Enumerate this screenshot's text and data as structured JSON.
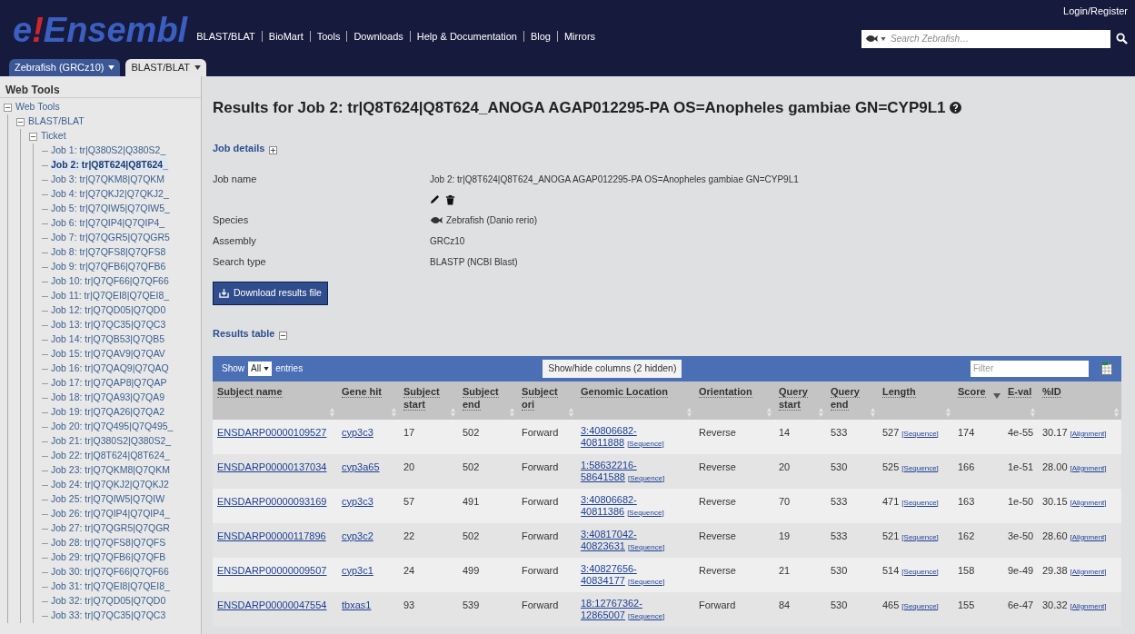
{
  "header": {
    "logo_mark": "e!",
    "logo_text": "Ensembl",
    "nav": [
      "BLAST/BLAT",
      "BioMart",
      "Tools",
      "Downloads",
      "Help & Documentation",
      "Blog",
      "Mirrors"
    ],
    "login": "Login/Register",
    "search": {
      "placeholder": "Search Zebrafish…"
    }
  },
  "tabs": [
    {
      "label": "Zebrafish (GRCz10)",
      "selected": false
    },
    {
      "label": "BLAST/BLAT",
      "selected": true
    }
  ],
  "sidebar": {
    "title": "Web Tools",
    "tree": [
      {
        "label": "Web Tools",
        "expanded": true,
        "children": [
          {
            "label": "BLAST/BLAT",
            "expanded": true,
            "children": [
              {
                "label": "Ticket",
                "expanded": true,
                "children": [
                  {
                    "label": "Job 1: tr|Q380S2|Q380S2_",
                    "selected": false
                  },
                  {
                    "label": "Job 2: tr|Q8T624|Q8T624_",
                    "selected": true
                  },
                  {
                    "label": "Job 3: tr|Q7QKM8|Q7QKM",
                    "selected": false
                  },
                  {
                    "label": "Job 4: tr|Q7QKJ2|Q7QKJ2_",
                    "selected": false
                  },
                  {
                    "label": "Job 5: tr|Q7QIW5|Q7QIW5_",
                    "selected": false
                  },
                  {
                    "label": "Job 6: tr|Q7QIP4|Q7QIP4_",
                    "selected": false
                  },
                  {
                    "label": "Job 7: tr|Q7QGR5|Q7QGR5",
                    "selected": false
                  },
                  {
                    "label": "Job 8: tr|Q7QFS8|Q7QFS8",
                    "selected": false
                  },
                  {
                    "label": "Job 9: tr|Q7QFB6|Q7QFB6",
                    "selected": false
                  },
                  {
                    "label": "Job 10: tr|Q7QF66|Q7QF66",
                    "selected": false
                  },
                  {
                    "label": "Job 11: tr|Q7QEI8|Q7QEI8_",
                    "selected": false
                  },
                  {
                    "label": "Job 12: tr|Q7QD05|Q7QD0",
                    "selected": false
                  },
                  {
                    "label": "Job 13: tr|Q7QC35|Q7QC3",
                    "selected": false
                  },
                  {
                    "label": "Job 14: tr|Q7QB53|Q7QB5",
                    "selected": false
                  },
                  {
                    "label": "Job 15: tr|Q7QAV9|Q7QAV",
                    "selected": false
                  },
                  {
                    "label": "Job 16: tr|Q7QAQ9|Q7QAQ",
                    "selected": false
                  },
                  {
                    "label": "Job 17: tr|Q7QAP8|Q7QAP",
                    "selected": false
                  },
                  {
                    "label": "Job 18: tr|Q7QA93|Q7QA9",
                    "selected": false
                  },
                  {
                    "label": "Job 19: tr|Q7QA26|Q7QA2",
                    "selected": false
                  },
                  {
                    "label": "Job 20: tr|Q7Q495|Q7Q495_",
                    "selected": false
                  },
                  {
                    "label": "Job 21: tr|Q380S2|Q380S2_",
                    "selected": false
                  },
                  {
                    "label": "Job 22: tr|Q8T624|Q8T624_",
                    "selected": false
                  },
                  {
                    "label": "Job 23: tr|Q7QKM8|Q7QKM",
                    "selected": false
                  },
                  {
                    "label": "Job 24: tr|Q7QKJ2|Q7QKJ2",
                    "selected": false
                  },
                  {
                    "label": "Job 25: tr|Q7QIW5|Q7QIW",
                    "selected": false
                  },
                  {
                    "label": "Job 26: tr|Q7QIP4|Q7QIP4_",
                    "selected": false
                  },
                  {
                    "label": "Job 27: tr|Q7QGR5|Q7QGR",
                    "selected": false
                  },
                  {
                    "label": "Job 28: tr|Q7QFS8|Q7QFS",
                    "selected": false
                  },
                  {
                    "label": "Job 29: tr|Q7QFB6|Q7QFB",
                    "selected": false
                  },
                  {
                    "label": "Job 30: tr|Q7QF66|Q7QF66",
                    "selected": false
                  },
                  {
                    "label": "Job 31: tr|Q7QEI8|Q7QEI8_",
                    "selected": false
                  },
                  {
                    "label": "Job 32: tr|Q7QD05|Q7QD0",
                    "selected": false
                  },
                  {
                    "label": "Job 33: tr|Q7QC35|Q7QC3",
                    "selected": false
                  }
                ]
              }
            ]
          }
        ]
      }
    ]
  },
  "main": {
    "title": "Results for Job 2: tr|Q8T624|Q8T624_ANOGA AGAP012295-PA OS=Anopheles gambiae GN=CYP9L1",
    "job_details": {
      "heading": "Job details",
      "expanded": false,
      "fields": [
        {
          "kind": "text",
          "label": "Job name",
          "value": "Job 2: tr|Q8T624|Q8T624_ANOGA AGAP012295-PA OS=Anopheles gambiae GN=CYP9L1"
        },
        {
          "kind": "actions"
        },
        {
          "kind": "species",
          "label": "Species",
          "value": "Zebrafish (Danio rerio)"
        },
        {
          "kind": "text",
          "label": "Assembly",
          "value": "GRCz10"
        },
        {
          "kind": "text",
          "label": "Search type",
          "value": "BLASTP (NCBI Blast)"
        }
      ]
    },
    "download_button": "Download results file",
    "results_heading": "Results table",
    "results_expanded": true,
    "table": {
      "show_label": "Show",
      "show_value": "All",
      "entries_label": "entries",
      "columns_button": "Show/hide columns (2 hidden)",
      "filter_placeholder": "Filter",
      "columns": [
        {
          "label": "Subject name",
          "sorted": false
        },
        {
          "label": "Gene hit",
          "sorted": false
        },
        {
          "label": "Subject start",
          "sorted": false
        },
        {
          "label": "Subject end",
          "sorted": false
        },
        {
          "label": "Subject ori",
          "sorted": false
        },
        {
          "label": "Genomic Location",
          "sorted": false
        },
        {
          "label": "Orientation",
          "sorted": false
        },
        {
          "label": "Query start",
          "sorted": false
        },
        {
          "label": "Query end",
          "sorted": false
        },
        {
          "label": "Length",
          "sorted": false
        },
        {
          "label": "Score",
          "sorted": true
        },
        {
          "label": "E-val",
          "sorted": false
        },
        {
          "label": "%ID",
          "sorted": false
        }
      ],
      "rows": [
        {
          "subject": "ENSDARP00000109527",
          "gene": "cyp3c3",
          "sstart": "17",
          "send": "502",
          "sori": "Forward",
          "location": [
            "3:40806682-",
            "40811888"
          ],
          "location_link": "[Sequence]",
          "orientation": "Reverse",
          "qstart": "14",
          "qend": "533",
          "length": "527",
          "length_link": "[Sequence]",
          "score": "174",
          "eval": "4e-55",
          "pid": "30.17",
          "pid_link": "[Alignment]"
        },
        {
          "subject": "ENSDARP00000137034",
          "gene": "cyp3a65",
          "sstart": "20",
          "send": "502",
          "sori": "Forward",
          "location": [
            "1:58632216-",
            "58641588"
          ],
          "location_link": "[Sequence]",
          "orientation": "Reverse",
          "qstart": "20",
          "qend": "530",
          "length": "525",
          "length_link": "[Sequence]",
          "score": "166",
          "eval": "1e-51",
          "pid": "28.00",
          "pid_link": "[Alignment]"
        },
        {
          "subject": "ENSDARP00000093169",
          "gene": "cyp3c3",
          "sstart": "57",
          "send": "491",
          "sori": "Forward",
          "location": [
            "3:40806682-",
            "40811386"
          ],
          "location_link": "[Sequence]",
          "orientation": "Reverse",
          "qstart": "70",
          "qend": "533",
          "length": "471",
          "length_link": "[Sequence]",
          "score": "163",
          "eval": "1e-50",
          "pid": "30.15",
          "pid_link": "[Alignment]"
        },
        {
          "subject": "ENSDARP00000117896",
          "gene": "cyp3c2",
          "sstart": "22",
          "send": "502",
          "sori": "Forward",
          "location": [
            "3:40817042-",
            "40823631"
          ],
          "location_link": "[Sequence]",
          "orientation": "Reverse",
          "qstart": "19",
          "qend": "533",
          "length": "521",
          "length_link": "[Sequence]",
          "score": "162",
          "eval": "3e-50",
          "pid": "28.60",
          "pid_link": "[Alignment]"
        },
        {
          "subject": "ENSDARP00000009507",
          "gene": "cyp3c1",
          "sstart": "24",
          "send": "499",
          "sori": "Forward",
          "location": [
            "3:40827656-",
            "40834177"
          ],
          "location_link": "[Sequence]",
          "orientation": "Reverse",
          "qstart": "21",
          "qend": "530",
          "length": "514",
          "length_link": "[Sequence]",
          "score": "158",
          "eval": "9e-49",
          "pid": "29.38",
          "pid_link": "[Alignment]"
        },
        {
          "subject": "ENSDARP00000047554",
          "gene": "tbxas1",
          "sstart": "93",
          "send": "539",
          "sori": "Forward",
          "location": [
            "18:12767362-",
            "12865007"
          ],
          "location_link": "[Sequence]",
          "orientation": "Forward",
          "qstart": "84",
          "qend": "530",
          "length": "465",
          "length_link": "[Sequence]",
          "score": "155",
          "eval": "6e-47",
          "pid": "30.32",
          "pid_link": "[Alignment]"
        }
      ]
    }
  }
}
